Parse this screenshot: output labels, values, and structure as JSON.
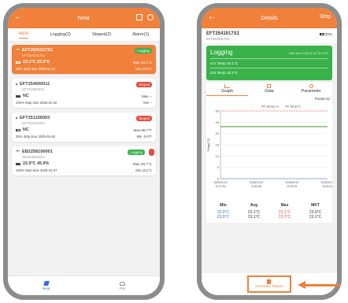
{
  "near": {
    "title": "Near",
    "back": "←",
    "tabs": [
      "All(4)",
      "Logging(2)",
      "Stoped(2)",
      "Alarm(1)"
    ],
    "devices": [
      {
        "sn": "EFT2541017S1",
        "sub": "EFT2541017S1",
        "status": "Logging",
        "vals": "23.1°C  23.2°C",
        "max": "23.1°C",
        "min": "23.0°C",
        "bat": "30%",
        "time_label": "Start time",
        "time": "2026-01-15",
        "max_label": "Max",
        "min_label": "Min"
      },
      {
        "sn": "EFT254000011",
        "sub": "EFT254000011",
        "status": "Stoped",
        "vals": "NC",
        "max": "--",
        "min": "--",
        "bat": "100%",
        "time_label": "Stop time",
        "time": "2026-01-02",
        "max_label": "Max",
        "min_label": "Min"
      },
      {
        "sn": "EFT251100003",
        "sub": "EFT251100003",
        "status": "Stoped",
        "vals": "NC",
        "max": "88.7°F",
        "min": "-9.9°F",
        "bat": "30%",
        "time_label": "Stop time",
        "time": "2025-04-28",
        "max_label": "Max",
        "min_label": "Min"
      },
      {
        "sn": "EB2258100001",
        "sub": "EB2258100001",
        "status": "Logging",
        "vals": "22.9°C  45.9%",
        "max": "25.7°C",
        "min": "18.2°C",
        "bat": "100%",
        "time_label": "Start time",
        "time": "2026-01-07",
        "max_label": "Max",
        "min_label": "Min"
      }
    ],
    "nav": [
      "Near",
      "File"
    ]
  },
  "details": {
    "title": "Details",
    "back": "←",
    "stop": "Stop",
    "sn": "EFT2541017S1",
    "sub": "EFT2541017S1",
    "battery": "30%",
    "status": "Logging",
    "start": "Start time 2026-01-15 10:47:52",
    "ch1": "ch1 Temp 23.1°C",
    "ch2": "ch2 Temp 23.2°C",
    "tabs": [
      "Graph",
      "Data",
      "Parameter"
    ],
    "points": "Points:42",
    "legend": [
      "Temp1°C",
      "Temp°C"
    ],
    "ylabel": "Temp(°C)",
    "stats": {
      "headers": [
        "Min",
        "Avg",
        "Max",
        "MKT"
      ],
      "row1": [
        "23.0°C",
        "23.1°C",
        "23.1°C",
        "23.0°C"
      ],
      "row2": [
        "23.0°C",
        "23.1°C",
        "23.2°C",
        "23.1°C"
      ]
    },
    "gen": "Generate Report"
  },
  "chart_data": {
    "type": "line",
    "ylabel": "Temp(°C)",
    "ylim": [
      0,
      30
    ],
    "yticks": [
      0,
      5,
      10,
      15,
      20,
      25,
      30
    ],
    "x": [
      "2026/01/15\n10:47:52",
      "2026/01/15\n10:50:08",
      "2026/01/15\n10:52:25",
      "2026/01/15\n10:54:42"
    ],
    "series": [
      {
        "name": "Temp1°C",
        "values": [
          23.1,
          23.1,
          23.1,
          23.1
        ],
        "color": "#e94b3c"
      },
      {
        "name": "Temp°C",
        "values": [
          23.0,
          23.0,
          23.0,
          23.0
        ],
        "color": "#3ab24a"
      }
    ],
    "limit_high": 30,
    "limit_low": 0
  },
  "colors": {
    "accent": "#f0803a",
    "green": "#3ab24a",
    "red": "#e94b3c",
    "blue": "#3a6fd8"
  }
}
